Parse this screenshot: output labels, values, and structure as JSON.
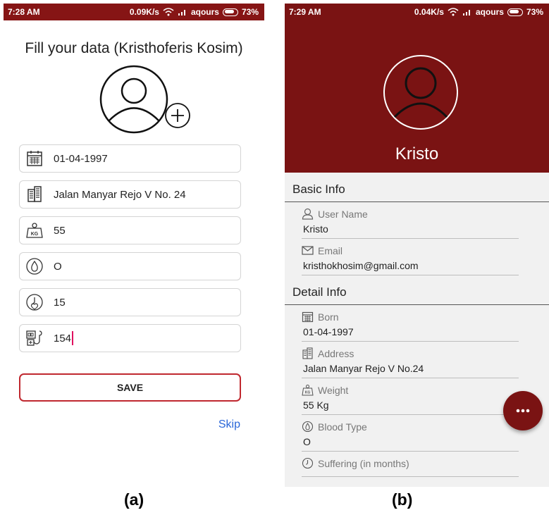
{
  "screen_a": {
    "status": {
      "time": "7:28 AM",
      "speed": "0.09K/s",
      "carrier": "aqours",
      "battery": "73%"
    },
    "title": "Fill your data  (Kristhoferis Kosim)",
    "fields": [
      {
        "icon": "calendar-icon",
        "value": "01-04-1997"
      },
      {
        "icon": "building-icon",
        "value": "Jalan Manyar Rejo V No. 24"
      },
      {
        "icon": "weight-scale-icon",
        "value": "55"
      },
      {
        "icon": "blood-drop-icon",
        "value": "O"
      },
      {
        "icon": "heart-timer-icon",
        "value": "15"
      },
      {
        "icon": "blood-pressure-icon",
        "value": "154"
      }
    ],
    "save_label": "SAVE",
    "skip_label": "Skip"
  },
  "screen_b": {
    "status": {
      "time": "7:29 AM",
      "speed": "0.04K/s",
      "carrier": "aqours",
      "battery": "73%"
    },
    "name": "Kristo",
    "basic_info_title": "Basic Info",
    "basic_info": [
      {
        "icon": "user-icon",
        "label": "User Name",
        "value": "Kristo"
      },
      {
        "icon": "mail-icon",
        "label": "Email",
        "value": "kristhokhosim@gmail.com"
      }
    ],
    "detail_info_title": "Detail Info",
    "detail_info": [
      {
        "icon": "calendar-icon",
        "label": "Born",
        "value": "01-04-1997"
      },
      {
        "icon": "building-icon",
        "label": "Address",
        "value": "Jalan Manyar Rejo V No.24"
      },
      {
        "icon": "weight-scale-icon",
        "label": "Weight",
        "value": "55 Kg"
      },
      {
        "icon": "blood-drop-icon",
        "label": "Blood Type",
        "value": "O"
      },
      {
        "icon": "heart-timer-icon",
        "label": "Suffering (in months)",
        "value": ""
      }
    ],
    "fab_icon": "more-options-icon"
  },
  "captions": {
    "a": "(a)",
    "b": "(b)"
  },
  "colors": {
    "brand": "#7a1313",
    "save_border": "#c0282f",
    "skip_link": "#2a66d8",
    "caret": "#e0115f"
  }
}
